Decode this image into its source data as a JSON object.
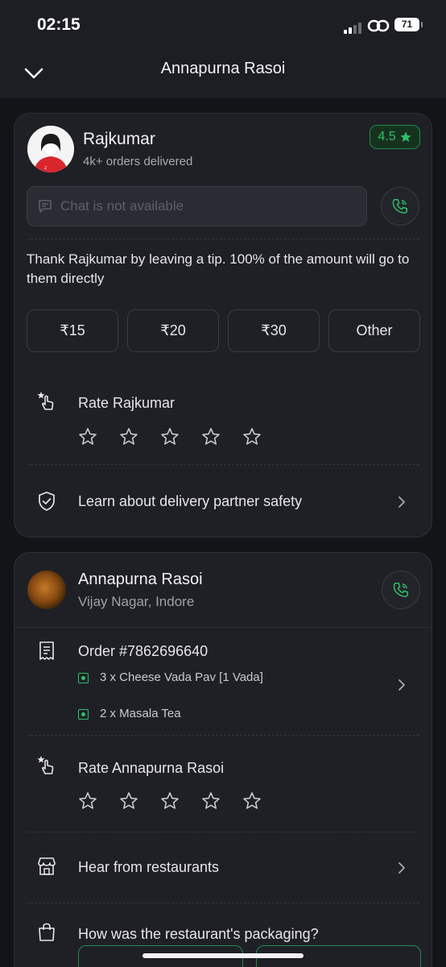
{
  "status_bar": {
    "time": "02:15",
    "battery": "71"
  },
  "header": {
    "title": "Annapurna Rasoi"
  },
  "rider": {
    "name": "Rajkumar",
    "subtitle": "4k+ orders delivered",
    "rating": "4.5",
    "chat_placeholder": "Chat is not available",
    "tip_message": "Thank Rajkumar by leaving a tip. 100% of the amount will go to them directly",
    "tips": [
      "₹15",
      "₹20",
      "₹30",
      "Other"
    ],
    "rate_label": "Rate Rajkumar",
    "safety_label": "Learn about delivery partner safety"
  },
  "restaurant": {
    "name": "Annapurna Rasoi",
    "location": "Vijay Nagar, Indore",
    "order_id": "Order #7862696640",
    "items": [
      "3 x Cheese Vada Pav [1 Vada]",
      "2 x Masala Tea"
    ],
    "rate_label": "Rate Annapurna Rasoi",
    "hear_label": "Hear from restaurants",
    "packaging_label": "How was the restaurant's packaging?"
  },
  "colors": {
    "accent_green": "#2FBF6A",
    "background": "#131418",
    "card": "#1F2026"
  }
}
